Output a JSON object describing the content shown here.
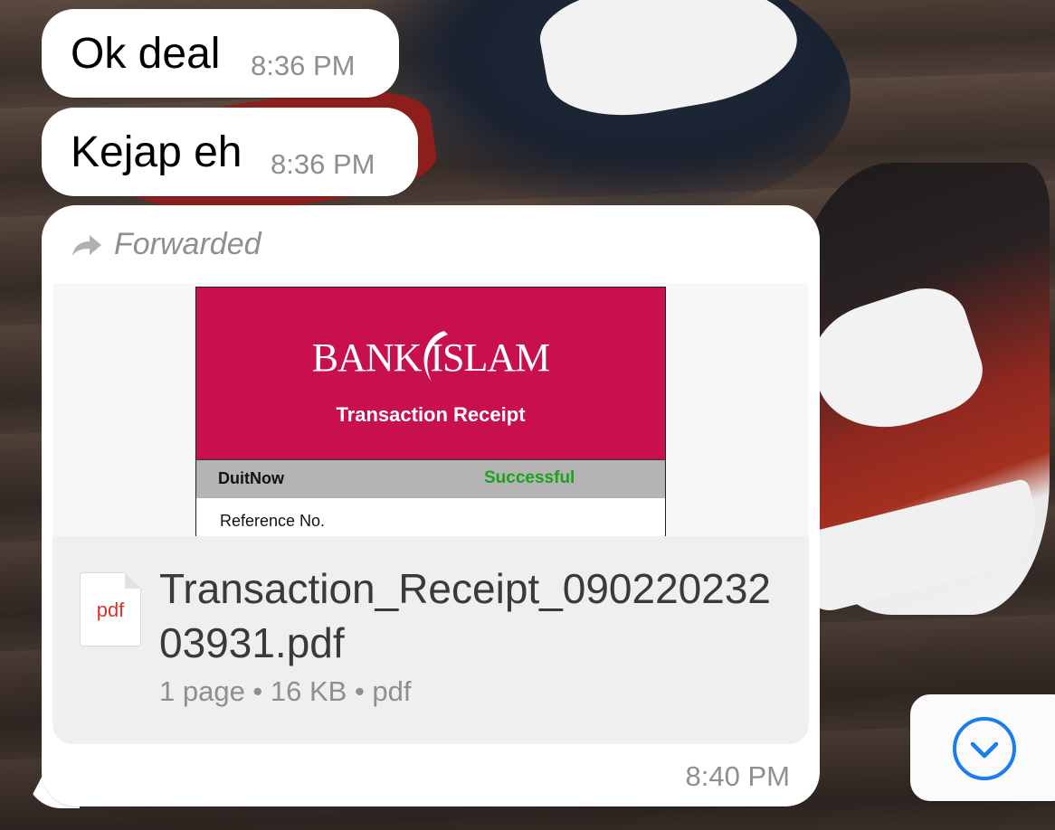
{
  "messages": [
    {
      "text": "Ok deal",
      "time": "8:36 PM"
    },
    {
      "text": "Kejap eh",
      "time": "8:36 PM"
    }
  ],
  "document_message": {
    "forwarded_label": "Forwarded",
    "preview": {
      "bank_name": "BANK ISLAM",
      "title": "Transaction Receipt",
      "method": "DuitNow",
      "status": "Successful",
      "reference_label": "Reference No."
    },
    "file_icon_label": "pdf",
    "file_name": "Transaction_Receipt_09022023203931.pdf",
    "file_meta": "1 page • 16 KB • pdf",
    "time": "8:40 PM"
  },
  "colors": {
    "bubble": "#ffffff",
    "timestamp": "#8e8e93",
    "bank_brand": "#c8104c",
    "status_success": "#1aa31a",
    "accent": "#1a7cf0"
  },
  "icons": [
    "forward-arrow-icon",
    "pdf-file-icon",
    "chevron-down-icon"
  ]
}
